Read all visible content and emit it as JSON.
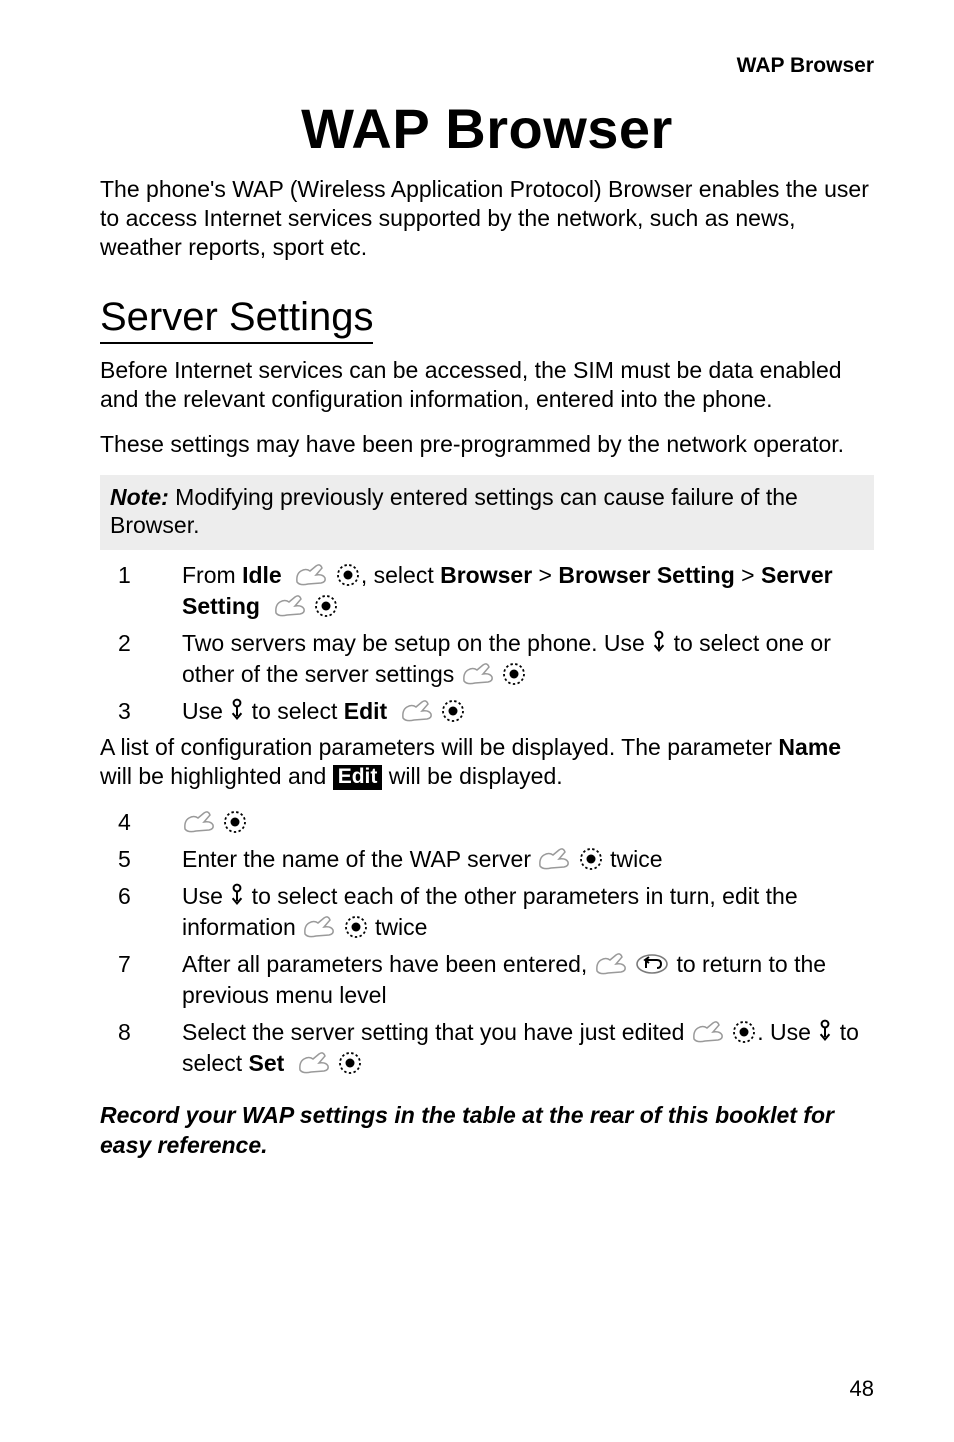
{
  "running_header": "WAP Browser",
  "title": "WAP Browser",
  "intro": "The phone's WAP (Wireless Application Protocol) Browser enables the user to access Internet services supported by the network, such as news, weather reports, sport etc.",
  "section_heading": "Server Settings",
  "section_p1": "Before Internet services can be accessed, the SIM must be data enabled and the relevant configuration information, entered into the phone.",
  "section_p2": "These settings may have been pre-programmed by the network operator.",
  "note_label": "Note:",
  "note_body": " Modifying previously entered settings can cause failure of the Browser.",
  "steps1": {
    "s1": {
      "from": "From ",
      "idle": "Idle",
      "select": ", select ",
      "browser": "Browser",
      "gt1": " > ",
      "browser_setting": "Browser Setting",
      "gt2": " > ",
      "server_setting": "Server Setting"
    },
    "s2": {
      "a": "Two servers may be setup on the phone. Use ",
      "b": " to select one or other of the server settings "
    },
    "s3": {
      "a": "Use ",
      "b": " to select ",
      "edit": "Edit"
    }
  },
  "mid_para_a": "A list of configuration parameters will be displayed. The parameter ",
  "mid_para_name": "Name",
  "mid_para_b": " will be highlighted and ",
  "mid_para_badge": "Edit",
  "mid_para_c": " will be displayed.",
  "steps2": {
    "s5": {
      "a": "Enter the name of the WAP server ",
      "b": " twice"
    },
    "s6": {
      "a": "Use ",
      "b": " to select each of the other parameters in turn, edit the information ",
      "c": " twice"
    },
    "s7": {
      "a": "After all parameters have been entered, ",
      "b": " to return to the previous menu level"
    },
    "s8": {
      "a": "Select the server setting that you have just edited ",
      "b": ". Use ",
      "c": " to select ",
      "set": "Set"
    }
  },
  "footer_ref": "Record your WAP settings in the table at the rear of this booklet for easy reference.",
  "page_number": "48"
}
